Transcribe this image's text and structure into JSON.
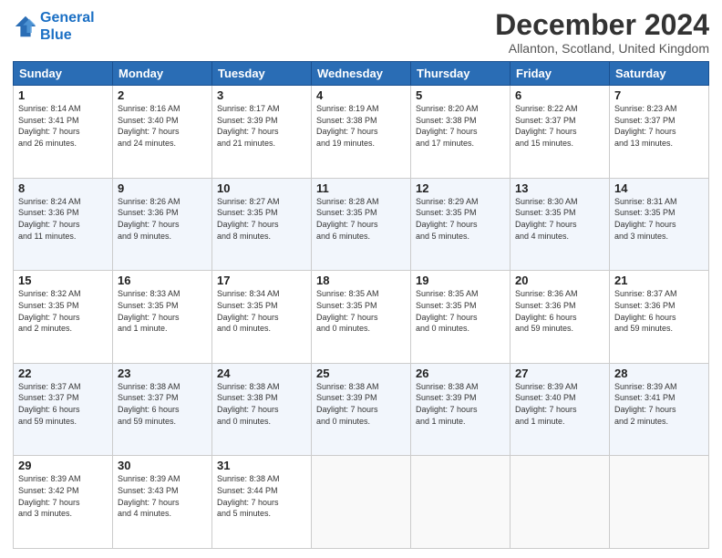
{
  "header": {
    "logo_line1": "General",
    "logo_line2": "Blue",
    "month_title": "December 2024",
    "subtitle": "Allanton, Scotland, United Kingdom"
  },
  "weekdays": [
    "Sunday",
    "Monday",
    "Tuesday",
    "Wednesday",
    "Thursday",
    "Friday",
    "Saturday"
  ],
  "weeks": [
    [
      {
        "day": "1",
        "info": "Sunrise: 8:14 AM\nSunset: 3:41 PM\nDaylight: 7 hours\nand 26 minutes."
      },
      {
        "day": "2",
        "info": "Sunrise: 8:16 AM\nSunset: 3:40 PM\nDaylight: 7 hours\nand 24 minutes."
      },
      {
        "day": "3",
        "info": "Sunrise: 8:17 AM\nSunset: 3:39 PM\nDaylight: 7 hours\nand 21 minutes."
      },
      {
        "day": "4",
        "info": "Sunrise: 8:19 AM\nSunset: 3:38 PM\nDaylight: 7 hours\nand 19 minutes."
      },
      {
        "day": "5",
        "info": "Sunrise: 8:20 AM\nSunset: 3:38 PM\nDaylight: 7 hours\nand 17 minutes."
      },
      {
        "day": "6",
        "info": "Sunrise: 8:22 AM\nSunset: 3:37 PM\nDaylight: 7 hours\nand 15 minutes."
      },
      {
        "day": "7",
        "info": "Sunrise: 8:23 AM\nSunset: 3:37 PM\nDaylight: 7 hours\nand 13 minutes."
      }
    ],
    [
      {
        "day": "8",
        "info": "Sunrise: 8:24 AM\nSunset: 3:36 PM\nDaylight: 7 hours\nand 11 minutes."
      },
      {
        "day": "9",
        "info": "Sunrise: 8:26 AM\nSunset: 3:36 PM\nDaylight: 7 hours\nand 9 minutes."
      },
      {
        "day": "10",
        "info": "Sunrise: 8:27 AM\nSunset: 3:35 PM\nDaylight: 7 hours\nand 8 minutes."
      },
      {
        "day": "11",
        "info": "Sunrise: 8:28 AM\nSunset: 3:35 PM\nDaylight: 7 hours\nand 6 minutes."
      },
      {
        "day": "12",
        "info": "Sunrise: 8:29 AM\nSunset: 3:35 PM\nDaylight: 7 hours\nand 5 minutes."
      },
      {
        "day": "13",
        "info": "Sunrise: 8:30 AM\nSunset: 3:35 PM\nDaylight: 7 hours\nand 4 minutes."
      },
      {
        "day": "14",
        "info": "Sunrise: 8:31 AM\nSunset: 3:35 PM\nDaylight: 7 hours\nand 3 minutes."
      }
    ],
    [
      {
        "day": "15",
        "info": "Sunrise: 8:32 AM\nSunset: 3:35 PM\nDaylight: 7 hours\nand 2 minutes."
      },
      {
        "day": "16",
        "info": "Sunrise: 8:33 AM\nSunset: 3:35 PM\nDaylight: 7 hours\nand 1 minute."
      },
      {
        "day": "17",
        "info": "Sunrise: 8:34 AM\nSunset: 3:35 PM\nDaylight: 7 hours\nand 0 minutes."
      },
      {
        "day": "18",
        "info": "Sunrise: 8:35 AM\nSunset: 3:35 PM\nDaylight: 7 hours\nand 0 minutes."
      },
      {
        "day": "19",
        "info": "Sunrise: 8:35 AM\nSunset: 3:35 PM\nDaylight: 7 hours\nand 0 minutes."
      },
      {
        "day": "20",
        "info": "Sunrise: 8:36 AM\nSunset: 3:36 PM\nDaylight: 6 hours\nand 59 minutes."
      },
      {
        "day": "21",
        "info": "Sunrise: 8:37 AM\nSunset: 3:36 PM\nDaylight: 6 hours\nand 59 minutes."
      }
    ],
    [
      {
        "day": "22",
        "info": "Sunrise: 8:37 AM\nSunset: 3:37 PM\nDaylight: 6 hours\nand 59 minutes."
      },
      {
        "day": "23",
        "info": "Sunrise: 8:38 AM\nSunset: 3:37 PM\nDaylight: 6 hours\nand 59 minutes."
      },
      {
        "day": "24",
        "info": "Sunrise: 8:38 AM\nSunset: 3:38 PM\nDaylight: 7 hours\nand 0 minutes."
      },
      {
        "day": "25",
        "info": "Sunrise: 8:38 AM\nSunset: 3:39 PM\nDaylight: 7 hours\nand 0 minutes."
      },
      {
        "day": "26",
        "info": "Sunrise: 8:38 AM\nSunset: 3:39 PM\nDaylight: 7 hours\nand 1 minute."
      },
      {
        "day": "27",
        "info": "Sunrise: 8:39 AM\nSunset: 3:40 PM\nDaylight: 7 hours\nand 1 minute."
      },
      {
        "day": "28",
        "info": "Sunrise: 8:39 AM\nSunset: 3:41 PM\nDaylight: 7 hours\nand 2 minutes."
      }
    ],
    [
      {
        "day": "29",
        "info": "Sunrise: 8:39 AM\nSunset: 3:42 PM\nDaylight: 7 hours\nand 3 minutes."
      },
      {
        "day": "30",
        "info": "Sunrise: 8:39 AM\nSunset: 3:43 PM\nDaylight: 7 hours\nand 4 minutes."
      },
      {
        "day": "31",
        "info": "Sunrise: 8:38 AM\nSunset: 3:44 PM\nDaylight: 7 hours\nand 5 minutes."
      },
      {
        "day": "",
        "info": ""
      },
      {
        "day": "",
        "info": ""
      },
      {
        "day": "",
        "info": ""
      },
      {
        "day": "",
        "info": ""
      }
    ]
  ]
}
